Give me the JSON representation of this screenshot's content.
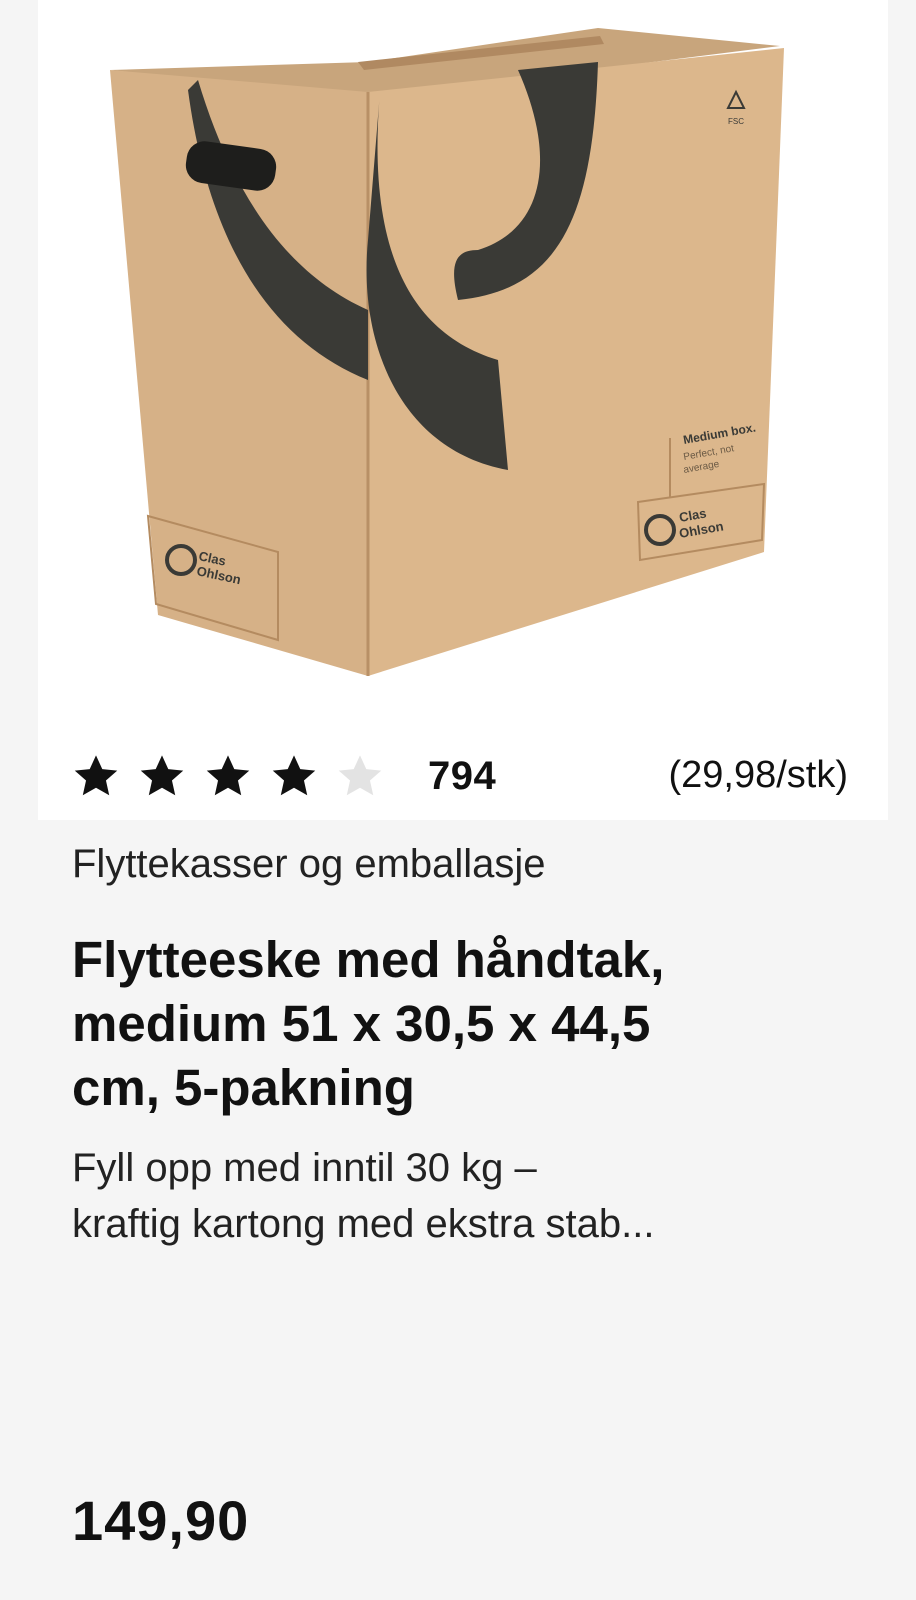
{
  "product": {
    "image_alt": "Flytteeske med håndtak",
    "box_print": {
      "brand_line1": "Clas",
      "brand_line2": "Ohlson",
      "size_label": "Medium box.",
      "tagline_line1": "Perfect, not",
      "tagline_line2": "average",
      "cert": "FSC"
    },
    "rating": {
      "value": 4,
      "max": 5,
      "count": "794"
    },
    "unit_price": "(29,98/stk)",
    "category": "Flyttekasser og emballasje",
    "title_lines": [
      "Flytteeske med håndtak,",
      "medium 51 x 30,5 x 44,5",
      "cm, 5-pakning"
    ],
    "description_lines": [
      "Fyll opp med inntil 30 kg –",
      "kraftig kartong med ekstra stab..."
    ],
    "price": "149,90"
  },
  "colors": {
    "cardboard": "#d9b48a",
    "cardboard_dark": "#c9a176",
    "print": "#3a3a36",
    "star_filled": "#111111",
    "star_empty": "#e3e3e3",
    "panel": "#f5f5f5"
  }
}
